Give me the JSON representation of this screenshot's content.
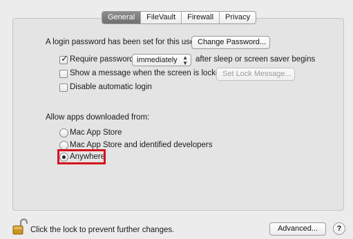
{
  "tabs": [
    {
      "label": "General",
      "active": true
    },
    {
      "label": "FileVault",
      "active": false
    },
    {
      "label": "Firewall",
      "active": false
    },
    {
      "label": "Privacy",
      "active": false
    }
  ],
  "login": {
    "text": "A login password has been set for this user",
    "change_password_label": "Change Password..."
  },
  "options": {
    "require_password": {
      "label": "Require password",
      "checked": true,
      "popup_value": "immediately",
      "suffix": "after sleep or screen saver begins"
    },
    "show_message": {
      "label": "Show a message when the screen is locked",
      "checked": false,
      "button_label": "Set Lock Message..."
    },
    "disable_auto_login": {
      "label": "Disable automatic login",
      "checked": false
    }
  },
  "allow_apps": {
    "heading": "Allow apps downloaded from:",
    "choices": [
      {
        "label": "Mac App Store",
        "selected": false
      },
      {
        "label": "Mac App Store and identified developers",
        "selected": false
      },
      {
        "label": "Anywhere",
        "selected": true
      }
    ]
  },
  "footer": {
    "lock_text": "Click the lock to prevent further changes.",
    "advanced_label": "Advanced...",
    "help_label": "?"
  },
  "colors": {
    "highlight": "#d4141c",
    "active_tab": "#7a7a7a"
  }
}
